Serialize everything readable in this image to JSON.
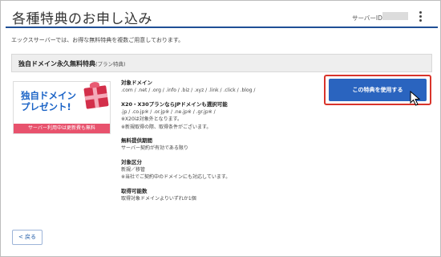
{
  "header": {
    "title": "各種特典のお申し込み",
    "server_label": "サーバーID"
  },
  "intro_text": "エックスサーバーでは、お得な無料特典を複数ご用意しております。",
  "section": {
    "title": "独自ドメイン永久無料特典",
    "subtitle": "(プラン特典)"
  },
  "banner": {
    "headline_line1": "独自ドメイン",
    "headline_line2": "プレゼント!",
    "bar_text": "サーバー利用中は更新費も無料"
  },
  "details": [
    {
      "label": "対象ドメイン",
      "lines": [
        ".com / .net / .org / .info / .biz / .xyz / .link / .click / .blog /"
      ]
    },
    {
      "label": "X20・X30プランならJPドメインも選択可能",
      "lines": [
        ".jp / .co.jp※ / .or.jp※ / .ne.jp※ / .gr.jp※ /",
        "※X20は対象外となります。",
        "※新規取得の際、取得条件がございます。"
      ]
    },
    {
      "label": "無料提供期間",
      "lines": [
        "サーバー契約が有効である限り"
      ]
    },
    {
      "label": "対象区分",
      "lines": [
        "新規／移管",
        "※当社でご契約中のドメインにも対応しています。"
      ]
    },
    {
      "label": "取得可能数",
      "lines": [
        "取得対象ドメインよりいずれか1個"
      ]
    }
  ],
  "apply_button_label": "この特典を使用する",
  "back_button_label": "< 戻る",
  "colors": {
    "accent_blue": "#2a64bf",
    "header_line": "#1f4f96",
    "highlight_red": "#d9342b",
    "banner_pink": "#e8526d"
  },
  "icons": {
    "menu": "kebab-menu-icon",
    "gift": "gift-icon",
    "cursor": "mouse-cursor-icon"
  }
}
